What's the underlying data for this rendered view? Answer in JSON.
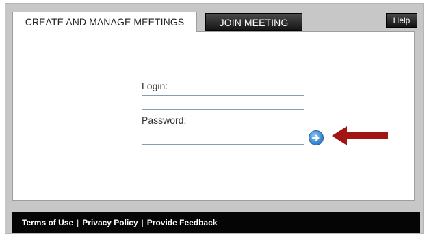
{
  "tabs": {
    "create_label": "CREATE AND MANAGE MEETINGS",
    "join_label": "JOIN MEETING"
  },
  "header": {
    "help_label": "Help"
  },
  "login_form": {
    "login_label": "Login:",
    "login_value": "",
    "password_label": "Password:",
    "password_value": "",
    "submit_icon": "arrow-right-circle-icon",
    "pointer_icon": "red-arrow-left-icon"
  },
  "footer": {
    "links": [
      "Terms of Use",
      "Privacy Policy",
      "Provide Feedback"
    ],
    "separator": "|"
  },
  "colors": {
    "frame": "#c7c7c7",
    "footer": "#050505",
    "go_button": "#3f8fd6",
    "pointer_arrow": "#a31515"
  }
}
